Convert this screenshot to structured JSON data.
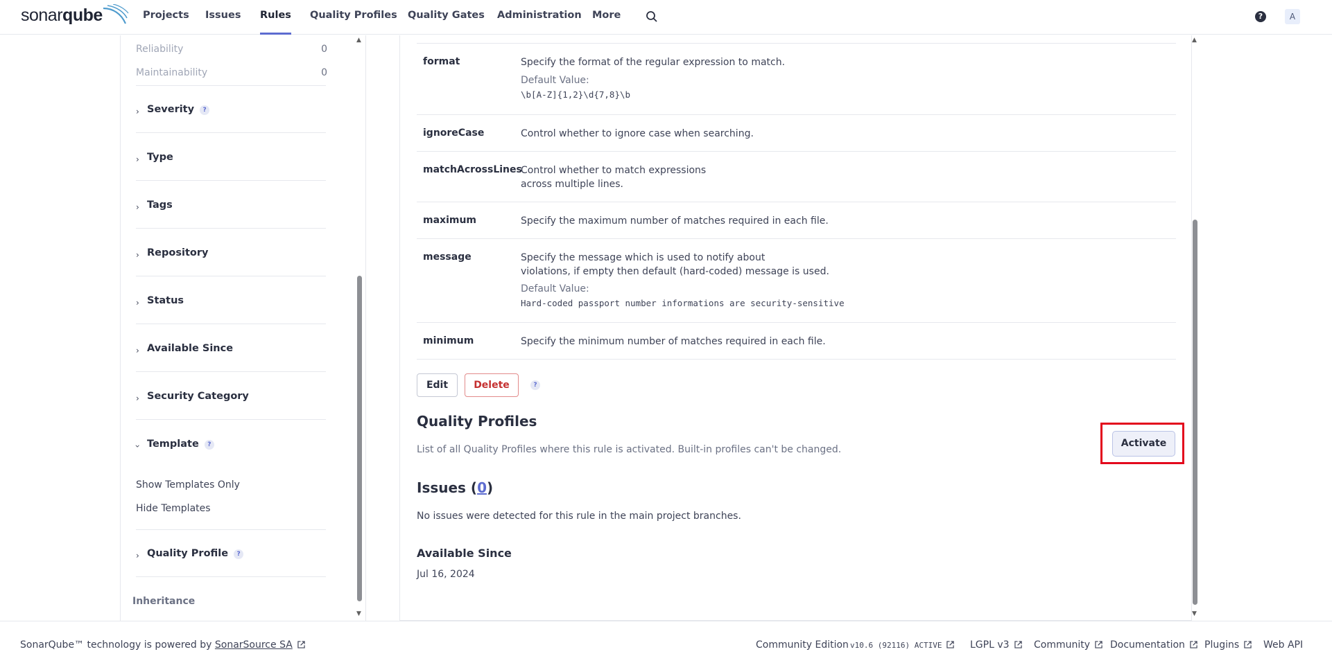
{
  "brand": {
    "sonar": "sonar",
    "qube": "qube"
  },
  "nav": {
    "items": [
      "Projects",
      "Issues",
      "Rules",
      "Quality Profiles",
      "Quality Gates",
      "Administration",
      "More"
    ],
    "active": "Rules",
    "avatar": "A"
  },
  "sidebar": {
    "metrics": [
      {
        "label": "Reliability",
        "count": "0"
      },
      {
        "label": "Maintainability",
        "count": "0"
      }
    ],
    "facets": [
      "Severity",
      "Type",
      "Tags",
      "Repository",
      "Status",
      "Available Since",
      "Security Category",
      "Template",
      "Quality Profile"
    ],
    "template_options": [
      "Show Templates Only",
      "Hide Templates"
    ],
    "inheritance": "Inheritance"
  },
  "params": [
    {
      "key": "format",
      "desc": "Specify the format of the regular expression to match.",
      "default_label": "Default Value:",
      "default": "\\b[A-Z]{1,2}\\d{7,8}\\b"
    },
    {
      "key": "ignoreCase",
      "desc": "Control whether to ignore case when searching."
    },
    {
      "key": "matchAcrossLines",
      "desc1": "Control whether to match expressions",
      "desc2": "across multiple lines."
    },
    {
      "key": "maximum",
      "desc": "Specify the maximum number of matches required in each file."
    },
    {
      "key": "message",
      "desc1": "Specify the message which is used to notify about",
      "desc2": "violations, if empty then default (hard-coded) message is used.",
      "default_label": "Default Value:",
      "default": "Hard-coded passport number informations are security-sensitive"
    },
    {
      "key": "minimum",
      "desc": "Specify the minimum number of matches required in each file."
    }
  ],
  "actions": {
    "edit": "Edit",
    "delete": "Delete"
  },
  "quality_profiles": {
    "title": "Quality Profiles",
    "desc": "List of all Quality Profiles where this rule is activated. Built-in profiles can't be changed.",
    "activate": "Activate"
  },
  "issues": {
    "title_prefix": "Issues (",
    "count": "0",
    "title_suffix": ")",
    "desc": "No issues were detected for this rule in the main project branches."
  },
  "available_since": {
    "title": "Available Since",
    "date": "Jul 16, 2024"
  },
  "footer": {
    "powered": "SonarQube™ technology is powered by ",
    "powered_link": "SonarSource SA",
    "edition": "Community Edition",
    "version": "v10.6 (92116) ACTIVE",
    "license": "LGPL v3",
    "community": "Community",
    "documentation": "Documentation",
    "plugins": "Plugins",
    "webapi": "Web API"
  },
  "colors": {
    "accent": "#5d6cd0",
    "danger": "#c53030",
    "highlight": "#e3061c"
  }
}
